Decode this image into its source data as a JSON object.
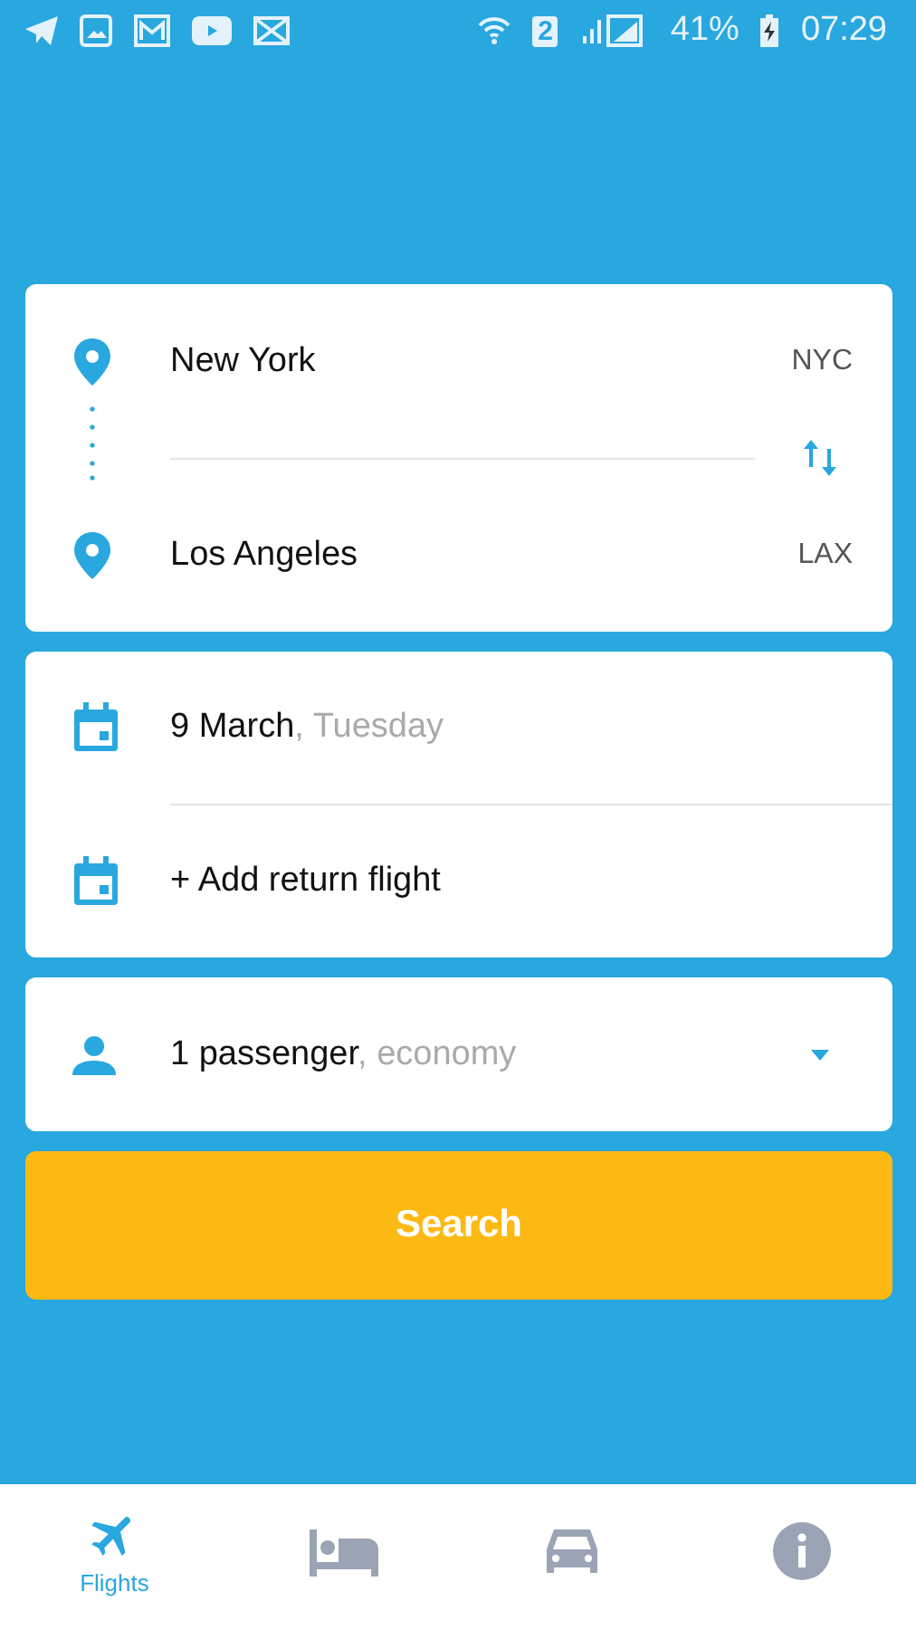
{
  "status_bar": {
    "sim": "2",
    "battery": "41%",
    "time": "07:29"
  },
  "route": {
    "origin": {
      "city": "New York",
      "code": "NYC"
    },
    "destination": {
      "city": "Los Angeles",
      "code": "LAX"
    }
  },
  "dates": [
    {
      "kind": "departure",
      "date": "9 March",
      "weekday": ", Tuesday"
    },
    {
      "kind": "return",
      "date": "+ Add return flight"
    }
  ],
  "passengers": {
    "count": "1 passenger",
    "cabin": ", economy"
  },
  "search_button": "Search",
  "tabs": [
    {
      "kind": "flights",
      "label": "Flights",
      "selected": true
    },
    {
      "kind": "hotels",
      "selected": false
    },
    {
      "kind": "cars",
      "selected": false
    },
    {
      "kind": "info",
      "selected": false
    }
  ]
}
